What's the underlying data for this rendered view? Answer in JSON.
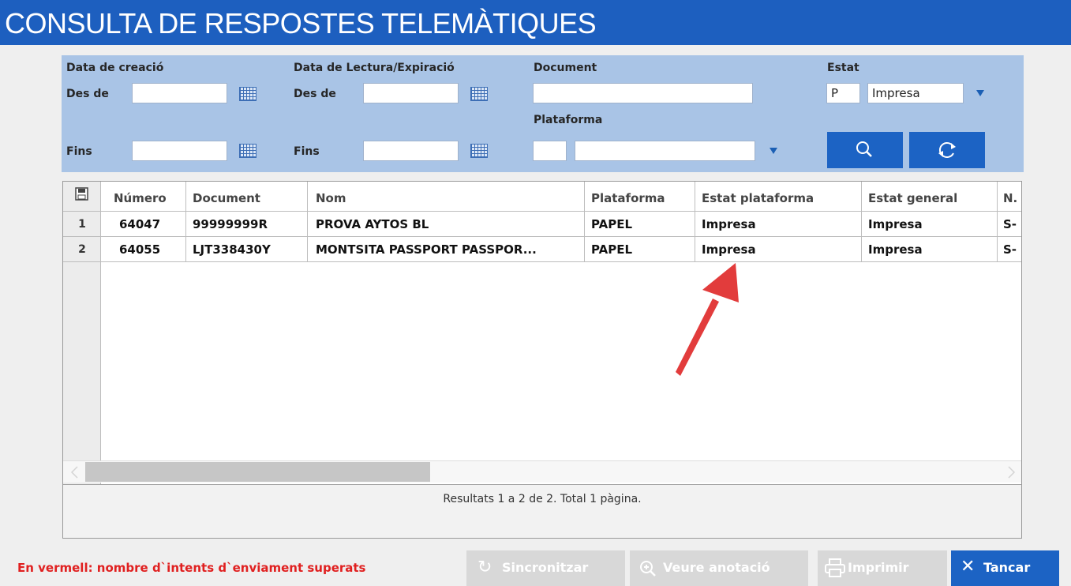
{
  "window": {
    "title": "CONSULTA DE RESPOSTES TELEMÀTIQUES"
  },
  "filters": {
    "data_creacio": {
      "label": "Data de creació",
      "from_label": "Des de",
      "to_label": "Fins",
      "from_value": "",
      "to_value": ""
    },
    "data_lectura": {
      "label": "Data de Lectura/Expiració",
      "from_label": "Des de",
      "to_label": "Fins",
      "from_value": "",
      "to_value": ""
    },
    "document": {
      "label": "Document",
      "value": ""
    },
    "plataforma": {
      "label": "Plataforma",
      "code": "",
      "value": ""
    },
    "estat": {
      "label": "Estat",
      "code": "P",
      "value": "Impresa"
    }
  },
  "icons": {
    "calendar": "calendar-icon",
    "dropdown": "dropdown-triangle-icon",
    "search": "search-icon",
    "refresh": "refresh-icon",
    "save": "save-icon",
    "sync": "sync-icon",
    "zoom": "zoom-icon",
    "print": "print-icon",
    "close": "close-icon"
  },
  "grid": {
    "columns": [
      "Número",
      "Document",
      "Nom",
      "Plataforma",
      "Estat plataforma",
      "Estat general",
      "N."
    ],
    "rows": [
      {
        "num": "1",
        "numero": "64047",
        "document": "99999999R",
        "nom": "PROVA AYTOS BL",
        "plataforma": "PAPEL",
        "estat_plataforma": "Impresa",
        "estat_general": "Impresa",
        "n": "S-"
      },
      {
        "num": "2",
        "numero": "64055",
        "document": "LJT338430Y",
        "nom": "MONTSITA PASSPORT PASSPOR...",
        "plataforma": "PAPEL",
        "estat_plataforma": "Impresa",
        "estat_general": "Impresa",
        "n": "S-"
      }
    ],
    "status": "Resultats 1 a 2 de 2. Total 1 pàgina."
  },
  "footer": {
    "note": "En vermell: nombre d`intents d`enviament superats",
    "buttons": {
      "sync": "Sincronitzar",
      "annotation": "Veure anotació",
      "print": "Imprimir",
      "close": "Tancar"
    }
  },
  "colors": {
    "title_bar": "#1d5fbf",
    "filter_panel": "#a9c4e6",
    "primary_button": "#1c63c4",
    "disabled_button": "#d8d8d8",
    "warning_text": "#e02020",
    "arrow": "#e23c3c"
  }
}
